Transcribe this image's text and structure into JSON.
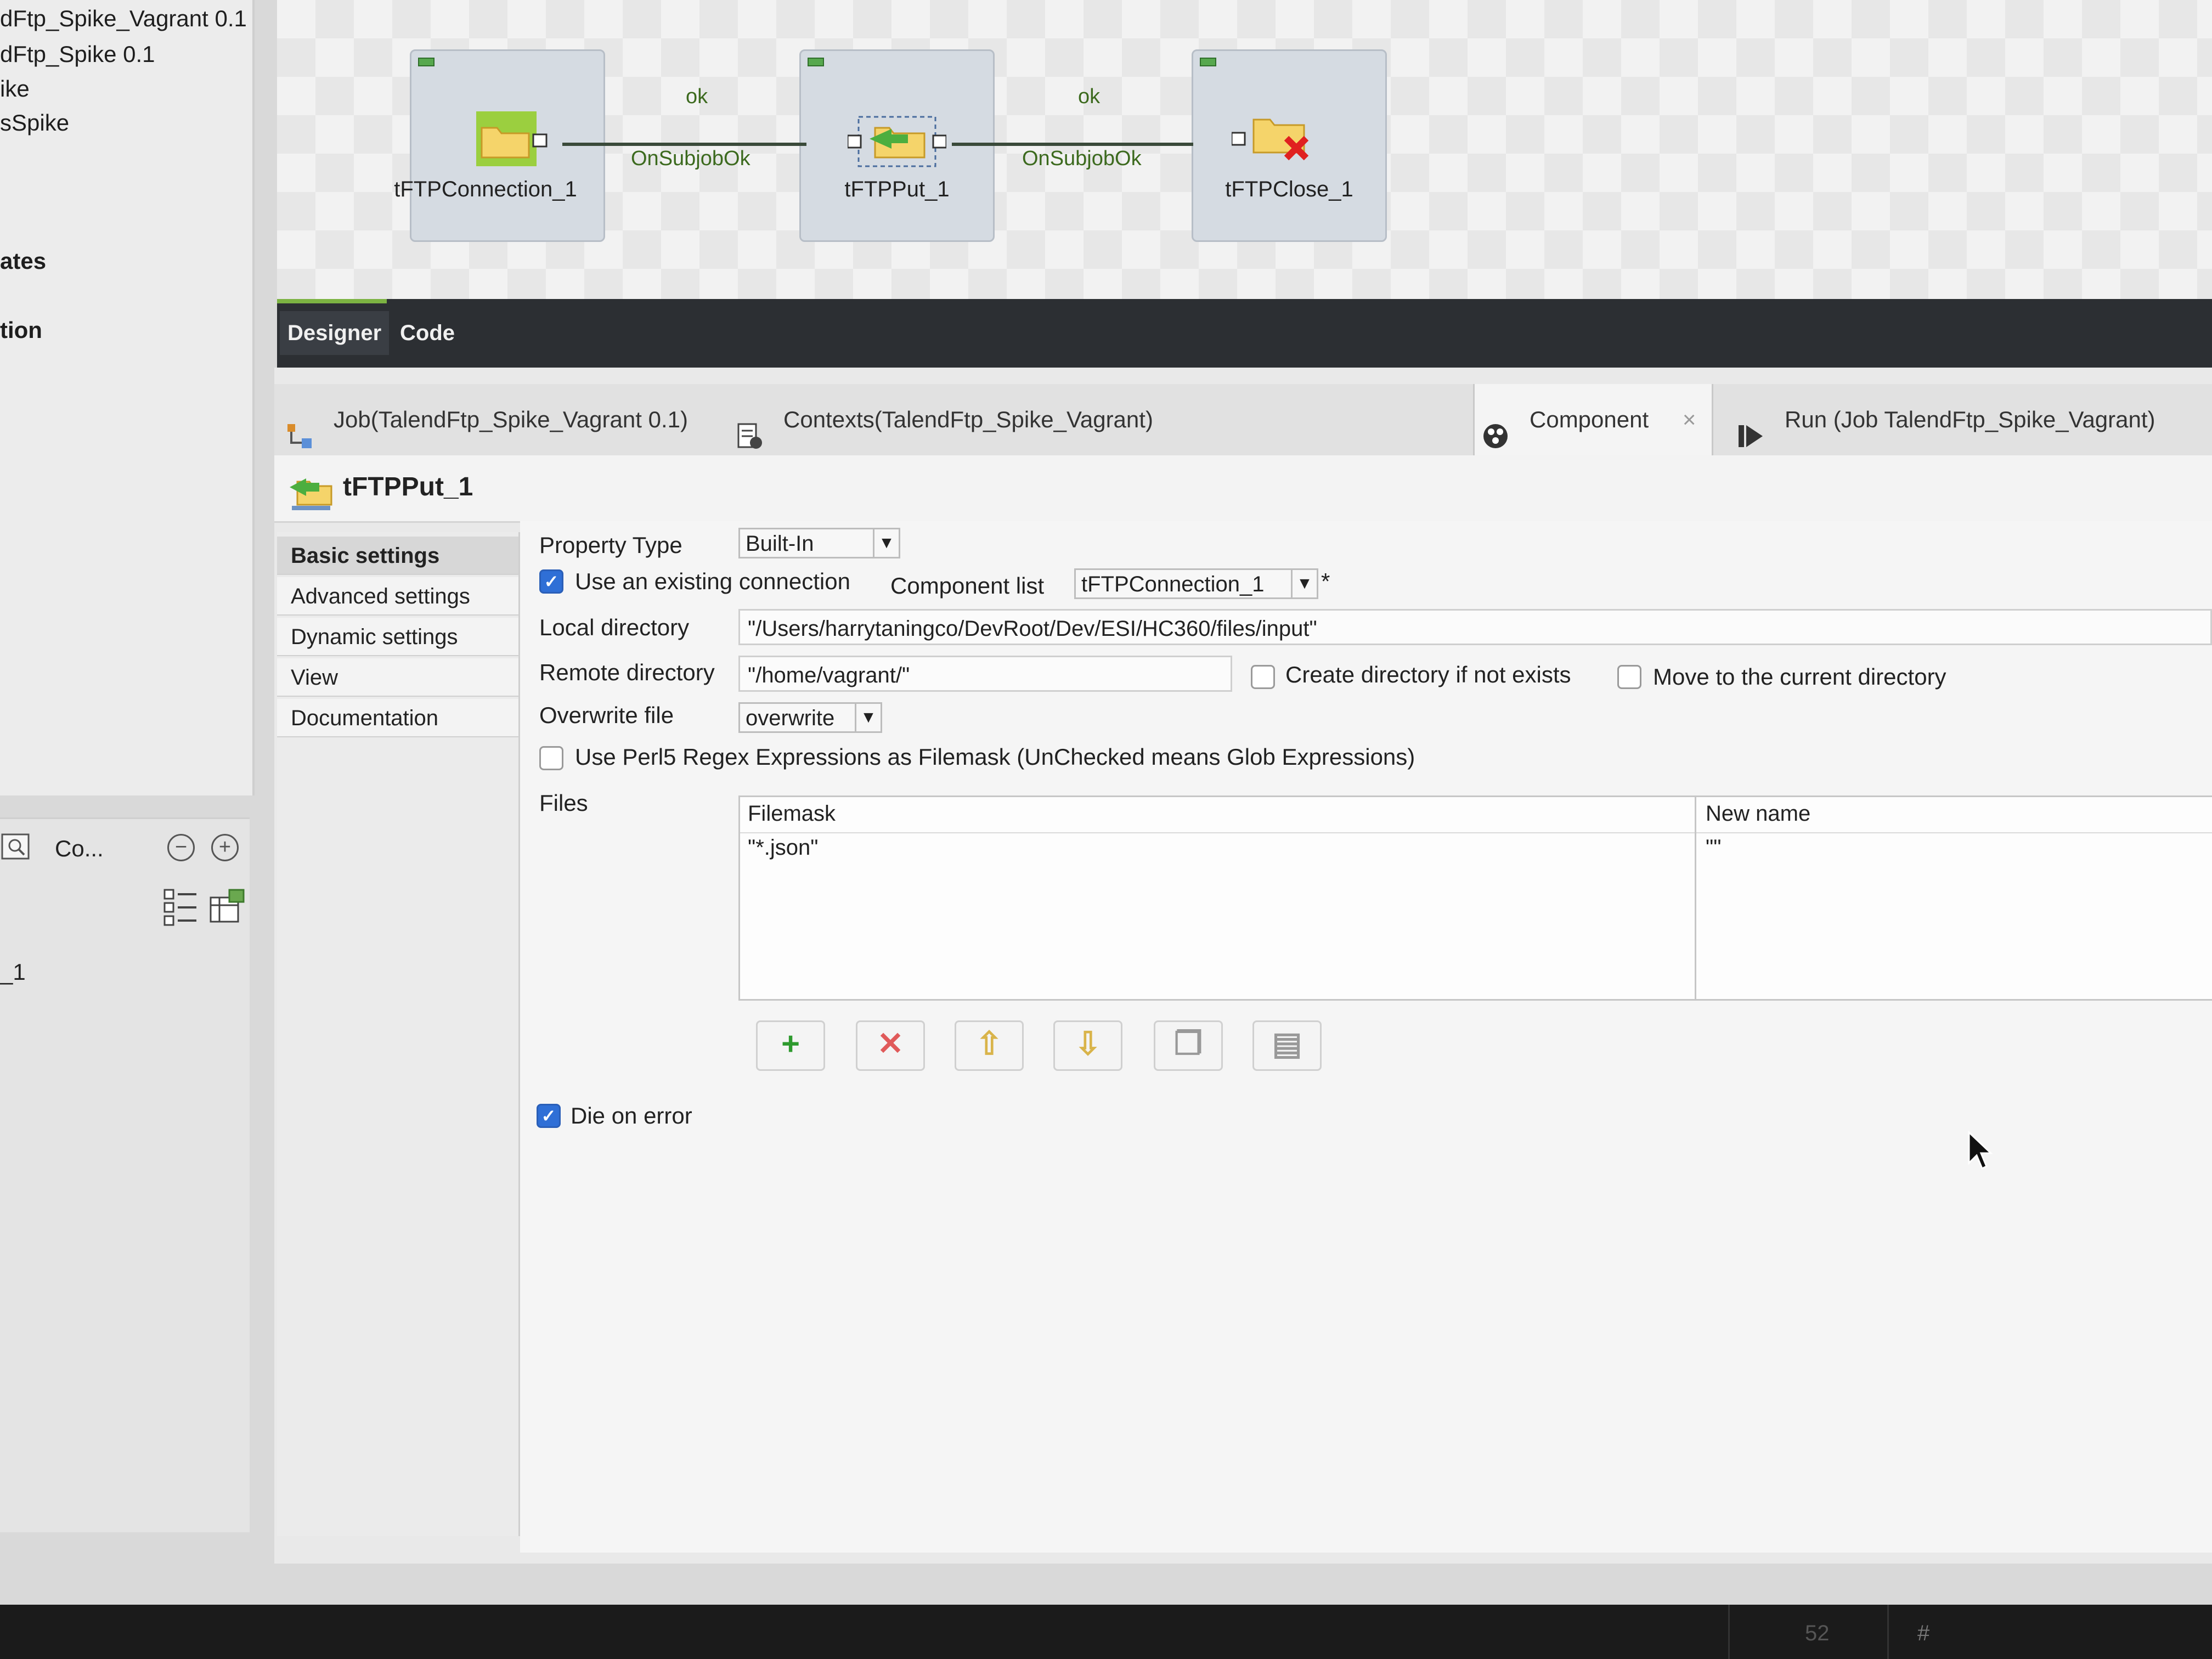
{
  "repository": {
    "items": [
      "dFtp_Spike_Vagrant 0.1",
      "dFtp_Spike 0.1",
      "ike",
      "sSpike",
      "ates",
      "tion"
    ]
  },
  "outline_panel": {
    "tab_label": "Co...",
    "collapse_symbol": "−",
    "expand_symbol": "+",
    "tree_item": "_1"
  },
  "canvas": {
    "nodes": [
      {
        "label": "tFTPConnection_1"
      },
      {
        "label": "tFTPPut_1"
      },
      {
        "label": "tFTPClose_1"
      }
    ],
    "links": [
      {
        "trigger": "OnSubjobOk",
        "status": "ok"
      },
      {
        "trigger": "OnSubjobOk",
        "status": "ok"
      }
    ]
  },
  "editor_tabs": {
    "designer": "Designer",
    "code": "Code",
    "active": "Designer"
  },
  "view_tabs": [
    {
      "label": "Job(TalendFtp_Spike_Vagrant 0.1)",
      "icon": "job-icon"
    },
    {
      "label": "Contexts(TalendFtp_Spike_Vagrant)",
      "icon": "contexts-icon"
    },
    {
      "label": "Component",
      "icon": "component-icon",
      "close": "×",
      "active": true
    },
    {
      "label": "Run (Job TalendFtp_Spike_Vagrant)",
      "icon": "run-icon"
    }
  ],
  "component": {
    "title": "tFTPPut_1",
    "nav": [
      "Basic settings",
      "Advanced settings",
      "Dynamic settings",
      "View",
      "Documentation"
    ],
    "active_nav": "Basic settings",
    "property_type": {
      "label": "Property Type",
      "value": "Built-In"
    },
    "use_existing_connection": {
      "label": "Use an existing connection",
      "checked": true
    },
    "component_list": {
      "label": "Component list",
      "value": "tFTPConnection_1",
      "marker": "*"
    },
    "local_directory": {
      "label": "Local directory",
      "value": "\"/Users/harrytaningco/DevRoot/Dev/ESI/HC360/files/input\""
    },
    "remote_directory": {
      "label": "Remote directory",
      "value": "\"/home/vagrant/\""
    },
    "create_directory": {
      "label": "Create directory if not exists",
      "checked": false
    },
    "move_to_current": {
      "label": "Move to the current directory",
      "checked": false
    },
    "overwrite_file": {
      "label": "Overwrite file",
      "value": "overwrite"
    },
    "perl_regex": {
      "label": "Use Perl5 Regex Expressions as Filemask (UnChecked means Glob Expressions)",
      "checked": false
    },
    "files": {
      "label": "Files",
      "columns": [
        "Filemask",
        "New name"
      ],
      "rows": [
        [
          "\"*.json\"",
          "\"\""
        ]
      ]
    },
    "table_buttons": [
      "add-icon",
      "remove-icon",
      "move-up-icon",
      "move-down-icon",
      "copy-icon",
      "paste-icon"
    ],
    "die_on_error": {
      "label": "Die on error",
      "checked": true
    }
  },
  "status_bar": {
    "line": "52",
    "symbol": "#"
  }
}
